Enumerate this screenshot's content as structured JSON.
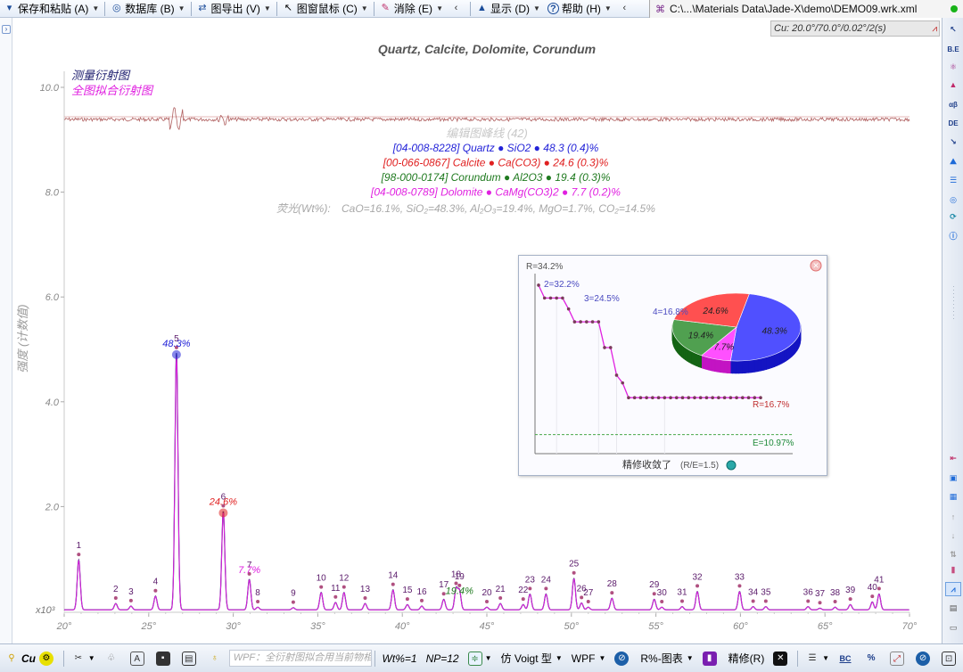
{
  "toolbar": {
    "items": [
      {
        "label": "保存和粘贴 (A)",
        "icon": "save-icon"
      },
      {
        "label": "数据库 (B)",
        "icon": "database-icon"
      },
      {
        "label": "图导出 (V)",
        "icon": "export-icon"
      },
      {
        "label": "图窗鼠标 (C)",
        "icon": "cursor-icon"
      },
      {
        "label": "消除 (E)",
        "icon": "eraser-icon"
      },
      {
        "label": "显示 (D)",
        "icon": "display-icon"
      },
      {
        "label": "帮助 (H)",
        "icon": "help-icon"
      }
    ],
    "file_path": "C:\\...\\Materials Data\\Jade-X\\demo\\DEMO09.wrk.xml"
  },
  "chart": {
    "title": "Quartz, Calcite, Dolomite, Corundum",
    "cu_info": "Cu: 20.0°/70.0°/0.02°/2(s)",
    "ylabel": "强度 (计数值)",
    "y_multiplier": "x10³",
    "legend_measured": "测量衍射图",
    "legend_fit": "全图拟合衍射图",
    "peak_list_label": "编辑图峰线 (42)",
    "phases": [
      {
        "pdf": "[04-008-8228]",
        "name": "Quartz",
        "formula_plain": "SiO2",
        "wt": "48.3 (0.4)%",
        "color": "#2323d8"
      },
      {
        "pdf": "[00-066-0867]",
        "name": "Calcite",
        "formula_plain": "Ca(CO3)",
        "wt": "24.6 (0.3)%",
        "color": "#e02020"
      },
      {
        "pdf": "[98-000-0174]",
        "name": "Corundum",
        "formula_plain": "Al2O3",
        "wt": "19.4 (0.3)%",
        "color": "#1f7a1f"
      },
      {
        "pdf": "[04-008-0789]",
        "name": "Dolomite",
        "formula_plain": "CaMg(CO3)2",
        "wt": "7.7 (0.2)%",
        "color": "#e020e0"
      }
    ],
    "oxides_prefix": "荧光(Wt%):",
    "oxides": "CaO=16.1%, SiO₂=48.3%, Al₂O₃=19.4%, MgO=1.7%, CO₂=14.5%",
    "peak_pct_labels": [
      {
        "text": "48.3%",
        "two_theta": 26.64,
        "height": 4.9,
        "color": "#2323d8"
      },
      {
        "text": "24.6%",
        "two_theta": 29.41,
        "height": 1.88,
        "color": "#e02020"
      },
      {
        "text": "7.7%",
        "two_theta": 30.95,
        "height": 0.58,
        "color": "#e020e0"
      },
      {
        "text": "19.4%",
        "two_theta": 43.38,
        "height": 0.18,
        "color": "#1f7a1f"
      }
    ]
  },
  "popup": {
    "r_start": "R=34.2%",
    "label2": "2=32.2%",
    "label3": "3=24.5%",
    "label4": "4=16.8%",
    "r_end": "R=16.7%",
    "e_label": "E=10.97%",
    "footer": "精修收敛了",
    "footer_sub": "(R/E=1.5)",
    "pie": [
      {
        "label": "48.3%",
        "value": 48.3,
        "color": "#5050ff"
      },
      {
        "label": "7.7%",
        "value": 7.7,
        "color": "#ff50ff"
      },
      {
        "label": "19.4%",
        "value": 19.4,
        "color": "#50a050"
      },
      {
        "label": "24.6%",
        "value": 24.6,
        "color": "#ff5050"
      }
    ]
  },
  "bottom": {
    "wavelength": "Cu",
    "wpf_placeholder": "WPF：全衍射图拟合用当前物相列或拾取",
    "wt_label": "Wt%=1",
    "np_label": "NP=12",
    "profile": "仿 Voigt 型",
    "wpf": "WPF",
    "r_chart": "R%-图表",
    "refine": "精修(R)"
  },
  "chart_data": {
    "type": "line",
    "title": "Quartz, Calcite, Dolomite, Corundum",
    "xlabel": "",
    "ylabel": "强度 (计数值)",
    "xlim": [
      20,
      70
    ],
    "ylim": [
      0,
      10.5
    ],
    "y_unit": "x10³",
    "x_ticks": [
      "20°",
      "25°",
      "30°",
      "35°",
      "40°",
      "45°",
      "50°",
      "55°",
      "60°",
      "65°",
      "70°"
    ],
    "y_ticks": [
      "2.0",
      "4.0",
      "6.0",
      "8.0",
      "10.0"
    ],
    "peaks": [
      {
        "n": "1",
        "x": 20.86,
        "y": 0.95
      },
      {
        "n": "2",
        "x": 23.05,
        "y": 0.12
      },
      {
        "n": "3",
        "x": 23.95,
        "y": 0.07
      },
      {
        "n": "4",
        "x": 25.4,
        "y": 0.26
      },
      {
        "n": "5",
        "x": 26.64,
        "y": 4.9
      },
      {
        "n": "6",
        "x": 29.41,
        "y": 1.88
      },
      {
        "n": "7",
        "x": 30.95,
        "y": 0.58
      },
      {
        "n": "8",
        "x": 31.45,
        "y": 0.05
      },
      {
        "n": "9",
        "x": 33.55,
        "y": 0.04
      },
      {
        "n": "10",
        "x": 35.2,
        "y": 0.33
      },
      {
        "n": "11",
        "x": 36.05,
        "y": 0.14
      },
      {
        "n": "12",
        "x": 36.55,
        "y": 0.33
      },
      {
        "n": "13",
        "x": 37.8,
        "y": 0.12
      },
      {
        "n": "14",
        "x": 39.45,
        "y": 0.38
      },
      {
        "n": "15",
        "x": 40.3,
        "y": 0.1
      },
      {
        "n": "16",
        "x": 41.15,
        "y": 0.07
      },
      {
        "n": "17",
        "x": 42.45,
        "y": 0.2
      },
      {
        "n": "18",
        "x": 43.18,
        "y": 0.4
      },
      {
        "n": "19",
        "x": 43.38,
        "y": 0.36
      },
      {
        "n": "20",
        "x": 45.0,
        "y": 0.05
      },
      {
        "n": "21",
        "x": 45.8,
        "y": 0.12
      },
      {
        "n": "22",
        "x": 47.15,
        "y": 0.1
      },
      {
        "n": "23",
        "x": 47.55,
        "y": 0.3
      },
      {
        "n": "24",
        "x": 48.5,
        "y": 0.3
      },
      {
        "n": "25",
        "x": 50.15,
        "y": 0.6
      },
      {
        "n": "26",
        "x": 50.6,
        "y": 0.13
      },
      {
        "n": "27",
        "x": 51.0,
        "y": 0.05
      },
      {
        "n": "28",
        "x": 52.4,
        "y": 0.22
      },
      {
        "n": "29",
        "x": 54.9,
        "y": 0.2
      },
      {
        "n": "30",
        "x": 55.35,
        "y": 0.05
      },
      {
        "n": "31",
        "x": 56.55,
        "y": 0.06
      },
      {
        "n": "32",
        "x": 57.45,
        "y": 0.35
      },
      {
        "n": "33",
        "x": 59.95,
        "y": 0.35
      },
      {
        "n": "34",
        "x": 60.75,
        "y": 0.06
      },
      {
        "n": "35",
        "x": 61.5,
        "y": 0.06
      },
      {
        "n": "36",
        "x": 64.0,
        "y": 0.06
      },
      {
        "n": "37",
        "x": 64.7,
        "y": 0.03
      },
      {
        "n": "38",
        "x": 65.6,
        "y": 0.05
      },
      {
        "n": "39",
        "x": 66.5,
        "y": 0.1
      },
      {
        "n": "40",
        "x": 67.8,
        "y": 0.15
      },
      {
        "n": "41",
        "x": 68.2,
        "y": 0.3
      }
    ],
    "refinement_R": [
      34.2,
      32.2,
      32.2,
      32.2,
      32.2,
      30.5,
      28.5,
      28.5,
      28.5,
      28.5,
      28.5,
      24.5,
      24.5,
      20.2,
      19.0,
      16.7,
      16.7,
      16.7,
      16.7,
      16.7,
      16.7,
      16.7,
      16.7,
      16.7,
      16.7,
      16.7,
      16.7,
      16.7,
      16.7,
      16.7,
      16.7,
      16.7,
      16.7,
      16.7,
      16.7,
      16.7,
      16.7,
      16.7
    ]
  }
}
